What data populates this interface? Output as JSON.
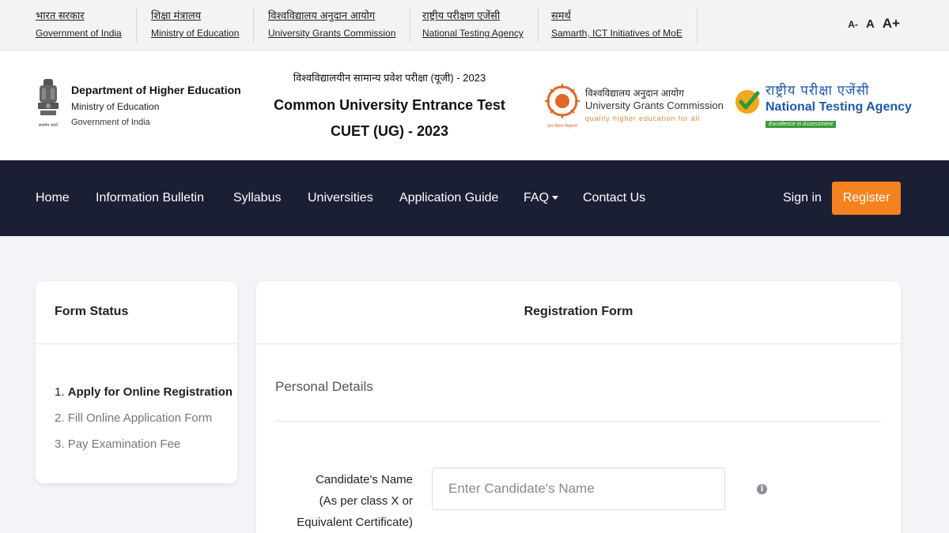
{
  "gov_links": [
    {
      "hi": "भारत सरकार",
      "en": "Government of India"
    },
    {
      "hi": "शिक्षा मंत्रालय",
      "en": "Ministry of Education"
    },
    {
      "hi": "विश्वविद्यालय अनुदान आयोग",
      "en": "University Grants Commission"
    },
    {
      "hi": "राष्ट्रीय परीक्षण एजेंसी",
      "en": "National Testing Agency"
    },
    {
      "hi": "समर्थ",
      "en": "Samarth, ICT Initiatives of MoE"
    }
  ],
  "font_controls": {
    "decrease": "A-",
    "normal": "A",
    "increase": "A+"
  },
  "header": {
    "dept_name": "Department of Higher Education",
    "ministry": "Ministry of Education",
    "government": "Government of India",
    "emblem_caption": "सत्यमेव जयते",
    "exam_hindi": "विश्वविद्यालयीन सामान्य प्रवेश परीक्षा (यूजी) - 2023",
    "exam_title": "Common University Entrance Test",
    "exam_subtitle": "CUET (UG) - 2023",
    "ugc_hindi": "विश्वविद्यालय अनुदान आयोग",
    "ugc_name": "University Grants Commission",
    "ugc_tagline": "quality higher education for all",
    "ugc_logo_caption": "ज्ञान-विज्ञान विमुक्तये",
    "nta_hindi": "राष्ट्रीय परीक्षा एजेंसी",
    "nta_name": "National Testing Agency",
    "nta_badge": "Excellence in Assessment"
  },
  "nav": {
    "items": [
      "Home",
      "Information Bulletin",
      "Syllabus",
      "Universities",
      "Application Guide",
      "FAQ",
      "Contact Us"
    ],
    "sign_in": "Sign in",
    "register": "Register"
  },
  "form_status": {
    "title": "Form Status",
    "steps": [
      {
        "num": "1.",
        "label": "Apply for Online Registration"
      },
      {
        "num": "2.",
        "label": "Fill Online Application Form"
      },
      {
        "num": "3.",
        "label": "Pay Examination Fee"
      }
    ]
  },
  "registration": {
    "title": "Registration Form",
    "section": "Personal Details",
    "name_label_1": "Candidate's Name",
    "name_label_2": "(As per class X or",
    "name_label_3": "Equivalent Certificate)",
    "name_placeholder": "Enter Candidate's Name",
    "info_glyph": "i"
  },
  "colors": {
    "nav_bg": "#1a1f33",
    "accent": "#f58220",
    "nta_blue": "#1e5aa8"
  }
}
